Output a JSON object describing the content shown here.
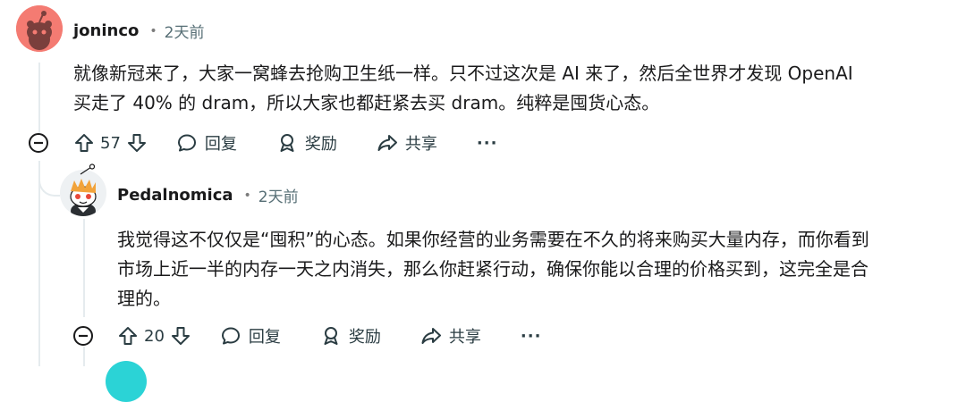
{
  "comments": [
    {
      "author": "joninco",
      "time": "2天前",
      "body": [
        "就像新冠来了，大家一窝蜂去抢购卫生纸一样。只不过这次是 AI 来了，然后全世界才发现 OpenAI",
        "买走了 40% 的 dram，所以大家也都赶紧去买 dram。纯粹是囤货心态。"
      ],
      "votes": "57",
      "reply": "回复",
      "award": "奖励",
      "share": "共享",
      "more": "···"
    },
    {
      "author": "Pedalnomica",
      "time": "2天前",
      "body": [
        "我觉得这不仅仅是“囤积”的心态。如果你经营的业务需要在不久的将来购买大量内存，而你看到",
        "市场上近一半的内存一天之内消失，那么你赶紧行动，确保你能以合理的价格买到，这完全是合",
        "理的。"
      ],
      "votes": "20",
      "reply": "回复",
      "award": "奖励",
      "share": "共享",
      "more": "···"
    }
  ],
  "colors": {
    "avatar1": "#f47b72",
    "avatar2_bg": "#f4f4f4",
    "next_avatar": "#2bd3d6"
  },
  "icons": [
    "collapse-icon",
    "upvote-icon",
    "downvote-icon",
    "reply-icon",
    "award-icon",
    "share-icon",
    "more-icon"
  ]
}
